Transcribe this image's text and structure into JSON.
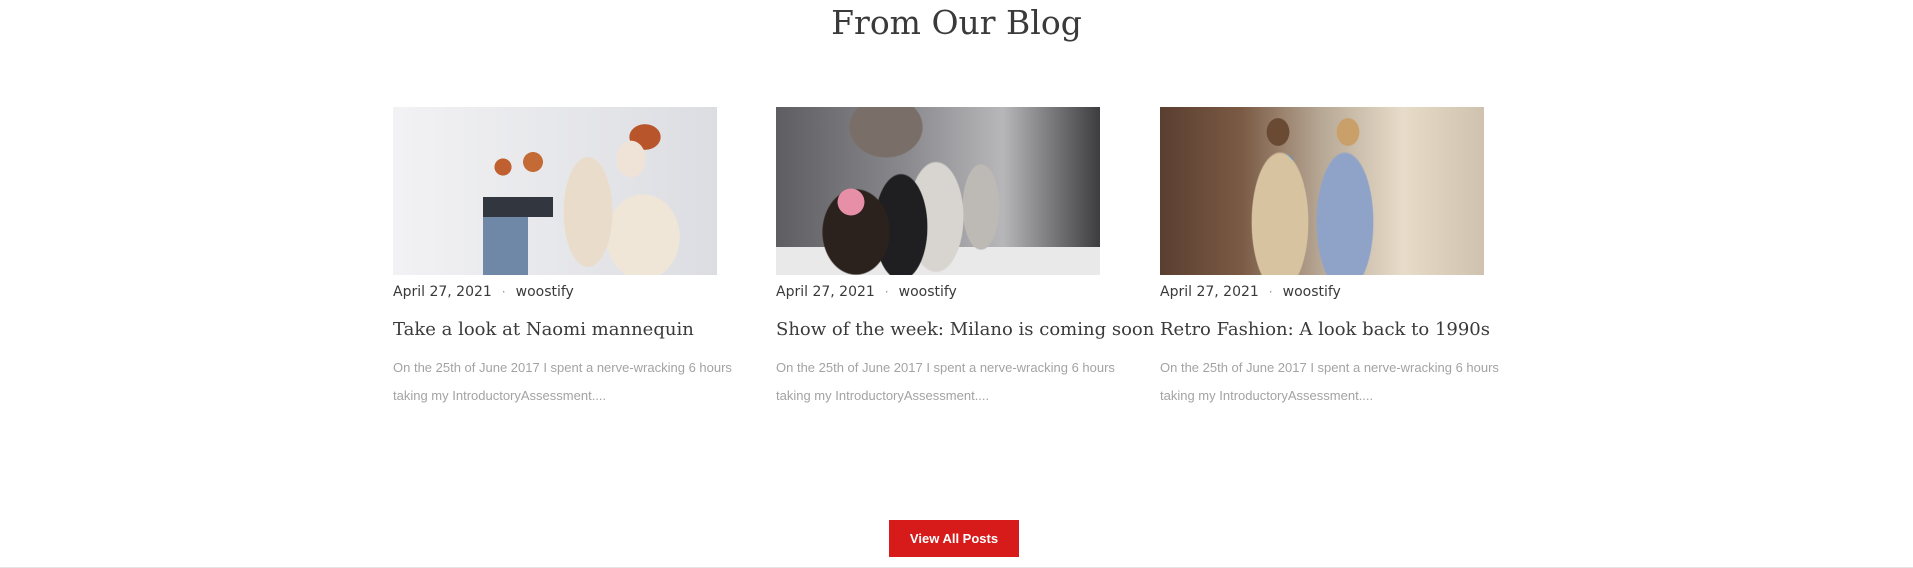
{
  "section": {
    "title": "From Our Blog"
  },
  "posts": [
    {
      "date": "April 27, 2021",
      "separator": "·",
      "author": "woostify",
      "title": "Take a look at Naomi mannequin",
      "excerpt": "On the 25th of June 2017 I spent a nerve-wracking 6 hours taking my IntroductoryAssessment...."
    },
    {
      "date": "April 27, 2021",
      "separator": "·",
      "author": "woostify",
      "title": "Show of the week: Milano is coming soon",
      "excerpt": "On the 25th of June 2017 I spent a nerve-wracking 6 hours taking my IntroductoryAssessment...."
    },
    {
      "date": "April 27, 2021",
      "separator": "·",
      "author": "woostify",
      "title": "Retro Fashion: A look back to 1990s",
      "excerpt": "On the 25th of June 2017 I spent a nerve-wracking 6 hours taking my IntroductoryAssessment...."
    }
  ],
  "cta": {
    "label": "View All Posts"
  },
  "colors": {
    "accent": "#d71a1a",
    "heading": "#3a3a3a",
    "muted": "#a3a3a3"
  }
}
